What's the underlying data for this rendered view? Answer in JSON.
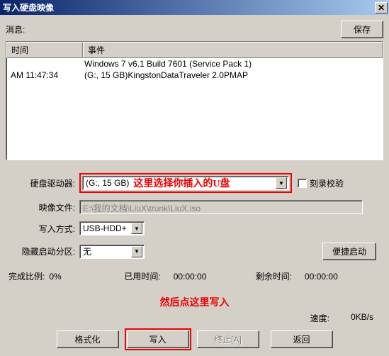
{
  "window": {
    "title": "写入硬盘映像"
  },
  "top": {
    "message_label": "消息:",
    "save_btn": "保存"
  },
  "log": {
    "headers": {
      "time": "时间",
      "event": "事件"
    },
    "rows": [
      {
        "time": "",
        "event": "Windows 7 v6.1 Build 7601 (Service Pack 1)"
      },
      {
        "time": "AM 11:47:34",
        "event": "(G:, 15 GB)KingstonDataTraveler 2.0PMAP"
      }
    ]
  },
  "form": {
    "drive_label": "硬盘驱动器:",
    "drive_value": "(G:, 15 GB)",
    "drive_note": "这里选择你插入的U盘",
    "verify_label": "刻录校验",
    "image_label": "映像文件:",
    "image_value": "E:\\我的文档\\LiuX\\trunk\\LiuX.iso",
    "write_method_label": "写入方式:",
    "write_method_value": "USB-HDD+",
    "hidden_label": "隐藏启动分区:",
    "hidden_value": "无",
    "convenient_btn": "便捷启动"
  },
  "status": {
    "complete_label": "完成比例:",
    "complete_value": "0%",
    "elapsed_label": "已用时间:",
    "elapsed_value": "00:00:00",
    "remain_label": "剩余时间:",
    "remain_value": "00:00:00"
  },
  "note2": "然后点这里写入",
  "speed": {
    "label": "速度:",
    "value": "0KB/s"
  },
  "actions": {
    "format": "格式化",
    "write": "写入",
    "abort": "终止[A]",
    "back": "返回"
  }
}
